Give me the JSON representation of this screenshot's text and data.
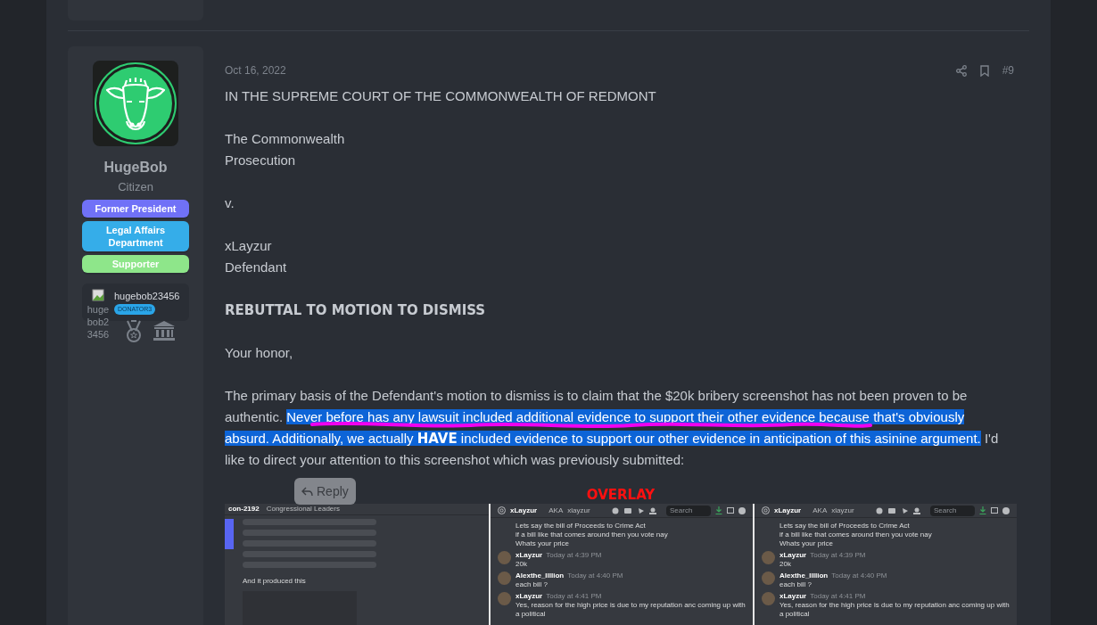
{
  "post": {
    "author": {
      "name": "HugeBob",
      "title": "Citizen",
      "banners": [
        {
          "label": "Former President",
          "color": "#7071f7"
        },
        {
          "label": "Legal Affairs Department",
          "color": "#35ade9"
        },
        {
          "label": "Supporter",
          "color": "#8ee68a"
        }
      ],
      "donor": {
        "image_alt": "hugebob23456",
        "username": "hugebob23456",
        "badge": "DONATOR3"
      }
    },
    "date": "Oct 16, 2022",
    "number": "#9",
    "body": [
      {
        "kind": "paragraph",
        "lines": [
          "IN THE SUPREME COURT OF THE COMMONWEALTH OF REDMONT"
        ]
      },
      {
        "kind": "paragraph",
        "lines": [
          "The Commonwealth",
          "Prosecution"
        ]
      },
      {
        "kind": "paragraph",
        "lines": [
          "v."
        ]
      },
      {
        "kind": "paragraph",
        "lines": [
          "xLayzur",
          "Defendant"
        ]
      },
      {
        "kind": "heading",
        "text": "REBUTTAL TO MOTION TO DISMISS"
      },
      {
        "kind": "paragraph",
        "lines": [
          "Your honor,"
        ]
      },
      {
        "kind": "segments",
        "segments": [
          {
            "text": "The primary basis of the Defendant's motion to dismiss is to claim that the $20k bribery screenshot has not been proven to be authentic. ",
            "selected": false
          },
          {
            "text": "Never before has any lawsuit included additional evidence to support their other evidence because that's obviously absurd. Additionally, we actually **HAVE** included evidence to support our other evidence in anticipation of this asinine argument.",
            "selected": true
          },
          {
            "text": " I'd like to direct your attention to this screenshot which was previously submitted:",
            "selected": false
          }
        ]
      }
    ],
    "reply_tooltip": {
      "label": "Reply"
    },
    "attachment": {
      "label": "OVERLAY",
      "panels": [
        {
          "kind": "channel",
          "channel": "con-2192",
          "topic": "Congressional Leaders",
          "caption": "And it produced this"
        },
        {
          "kind": "dm",
          "user": "xLayzur",
          "aka": "AKA",
          "alias": "xlayzur",
          "search_placeholder": "Search",
          "intro_lines": [
            "Lets say the bill of Proceeds to Crime Act",
            "if a bill like that comes around then you vote nay",
            "Whats your price"
          ],
          "messages": [
            {
              "author": "xLayzur",
              "time": "Today at 4:39 PM",
              "text": "20k"
            },
            {
              "author": "Alexthe_Illlion",
              "time": "Today at 4:40 PM",
              "text": "each bill ?"
            },
            {
              "author": "xLayzur",
              "time": "Today at 4:41 PM",
              "text": "Yes, reason for the high price is due to my reputation anc coming up with a political"
            }
          ]
        },
        {
          "kind": "dm",
          "user": "xLayzur",
          "aka": "AKA",
          "alias": "xlayzur",
          "search_placeholder": "Search",
          "intro_lines": [
            "Lets say the bill of Proceeds to Crime Act",
            "if a bill like that comes around then you vote nay",
            "Whats your price"
          ],
          "messages": [
            {
              "author": "xLayzur",
              "time": "Today at 4:39 PM",
              "text": "20k"
            },
            {
              "author": "Alexthe_Illlion",
              "time": "Today at 4:40 PM",
              "text": "each bill ?"
            },
            {
              "author": "xLayzur",
              "time": "Today at 4:41 PM",
              "text": "Yes, reason for the high price is due to my reputation anc coming up with a political"
            }
          ]
        }
      ]
    }
  }
}
